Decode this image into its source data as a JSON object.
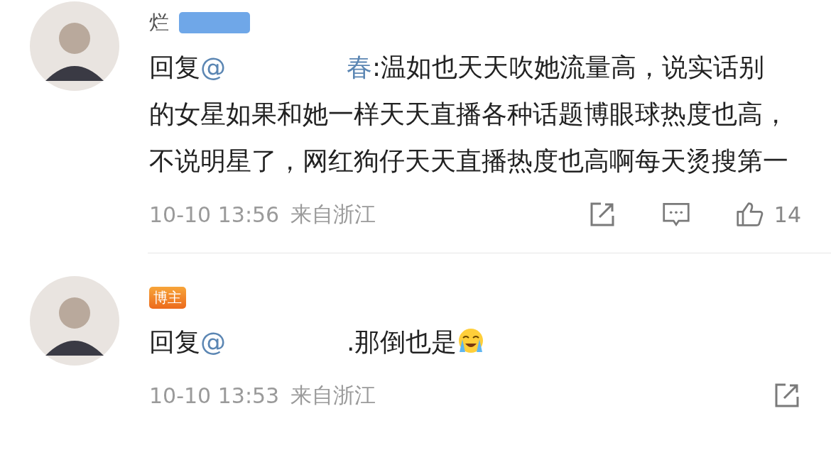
{
  "comments": [
    {
      "name": "烂",
      "badge": {
        "kind": "vip"
      },
      "content": [
        {
          "kind": "text",
          "text": "回复"
        },
        {
          "kind": "mention",
          "text": "@"
        },
        {
          "kind": "erased"
        },
        {
          "kind": "mention",
          "text": "春"
        },
        {
          "kind": "text",
          "text": ":温如也天天吹她流量高，说实话别的女星如果和她一样天天直播各种话题博眼球热度也高，不说明星了，网红狗仔天天直播热度也高啊每天烫搜第一"
        }
      ],
      "date": "10-10 13:56",
      "location": "来自浙江",
      "actions": [
        {
          "kind": "share"
        },
        {
          "kind": "comment"
        },
        {
          "kind": "like",
          "count": "14"
        }
      ]
    },
    {
      "badge": {
        "kind": "author",
        "text": "博主"
      },
      "content": [
        {
          "kind": "text",
          "text": "回复"
        },
        {
          "kind": "mention",
          "text": "@"
        },
        {
          "kind": "erased"
        },
        {
          "kind": "text",
          "text": ".那倒也是"
        },
        {
          "kind": "emoji"
        }
      ],
      "date": "10-10 13:53",
      "location": "来自浙江",
      "actions": [
        {
          "kind": "share"
        }
      ]
    }
  ]
}
